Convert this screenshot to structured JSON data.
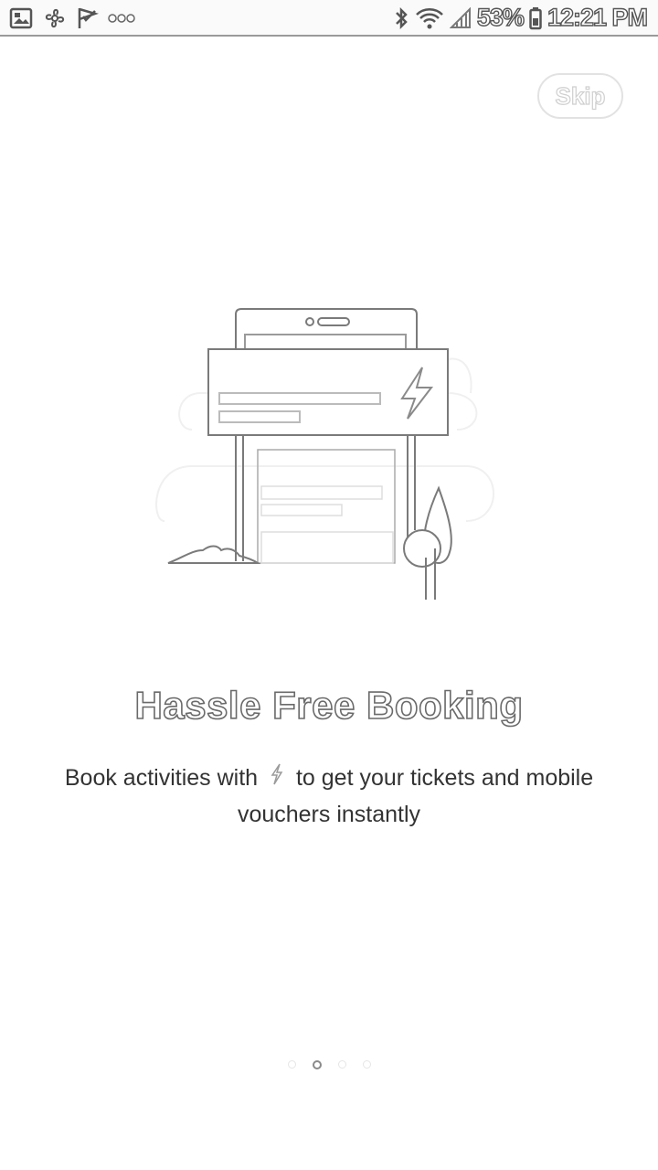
{
  "status_bar": {
    "battery": "53%",
    "time": "12:21 PM",
    "left_icons": [
      "gallery-icon",
      "pinwheel-icon",
      "checkmark-flag-icon",
      "more-dots-icon"
    ],
    "right_icons": [
      "bluetooth-icon",
      "wifi-icon",
      "signal-icon",
      "battery-icon"
    ]
  },
  "onboarding": {
    "skip_label": "Skip",
    "title": "Hassle Free Booking",
    "description_part1": "Book activities with",
    "description_part2": "to get your tickets and mobile vouchers instantly",
    "inline_icon": "lightning-bolt-icon",
    "illustration": "booking-kiosk-illustration"
  },
  "page_indicator": {
    "total": 4,
    "active_index": 1
  },
  "colors": {
    "background": "#ffffff",
    "outline": "#7a7a7a",
    "text": "#333333",
    "dot_inactive": "#e6e6e6",
    "dot_active": "#8a8a8a"
  }
}
